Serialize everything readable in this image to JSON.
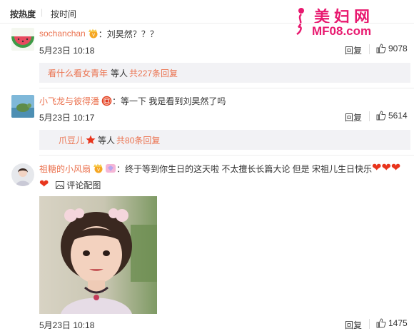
{
  "sort": {
    "hot": "按热度",
    "separator": "|",
    "time": "按时间"
  },
  "watermark": {
    "title": "美妇网",
    "url": "MF08.com"
  },
  "comments": [
    {
      "user": "sochanchan",
      "text": "：刘昊然？？？",
      "time": "5月23日 10:18",
      "reply_label": "回复",
      "likes": "9078",
      "sub": {
        "user": "看什么看女青年",
        "others": "等人",
        "count": "共227条回复"
      }
    },
    {
      "user": "小飞龙与彼得潘",
      "text": "：等一下 我是看到刘昊然了吗",
      "time": "5月23日 10:17",
      "reply_label": "回复",
      "likes": "5614",
      "sub": {
        "user": "爪豆儿",
        "others": "等人",
        "count": "共80条回复"
      }
    },
    {
      "user": "祖糖的小风扇",
      "text": "：终于等到你生日的这天啦 不太擅长长篇大论 但是 宋祖儿生日快乐",
      "comment_image_label": "评论配图",
      "time": "5月23日 10:18",
      "reply_label": "回复",
      "likes": "1475"
    }
  ],
  "icons": {
    "like": "thumbs-up-icon",
    "image": "picture-icon",
    "heart": "heart-icon",
    "crown_badge": "vip-crown-badge-icon",
    "red_badge": "red-circle-badge-icon",
    "star": "star-icon"
  },
  "colors": {
    "username": "#eb7350",
    "heart": "#e8351d",
    "sub_box_bg": "#f2f2f5",
    "watermark": "#e8196f"
  }
}
